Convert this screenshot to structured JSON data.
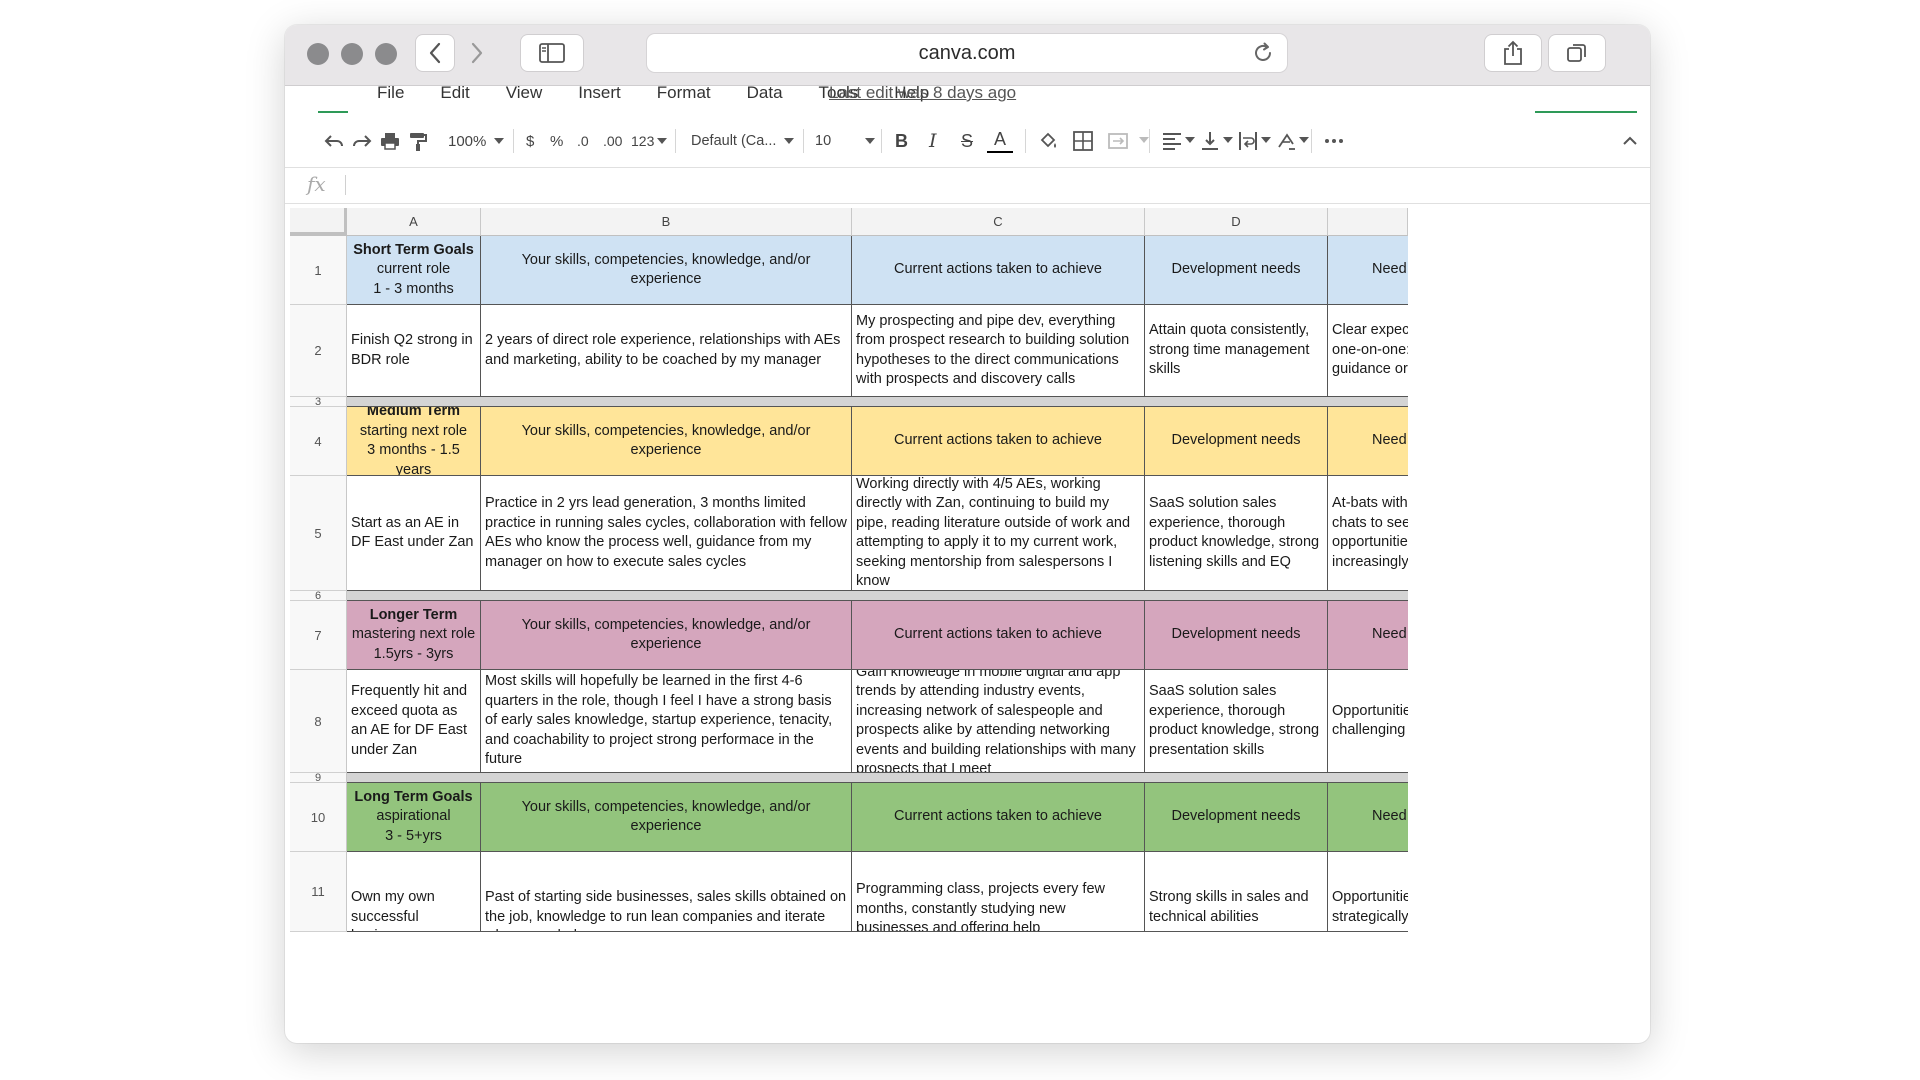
{
  "browser": {
    "url": "canva.com"
  },
  "menu": {
    "items": [
      "File",
      "Edit",
      "View",
      "Insert",
      "Format",
      "Data",
      "Tools",
      "Help"
    ],
    "last_edit": "Last edit was 8 days ago"
  },
  "toolbar": {
    "zoom": "100%",
    "currency": "$",
    "percent": "%",
    "dec_decrease": ".0",
    "dec_increase": ".00",
    "more_formats": "123",
    "font": "Default (Ca...",
    "font_size": "10",
    "bold": "B",
    "italic": "I",
    "strike": "S",
    "text_color": "A"
  },
  "formula_bar": {
    "fx": "fx",
    "value": ""
  },
  "columns": [
    "A",
    "B",
    "C",
    "D"
  ],
  "rows": [
    {
      "num": "1",
      "cells": [
        "Short Term Goals",
        "current role\n1 - 3 months",
        "Your skills, competencies, knowledge, and/or experience",
        "Current actions taken to achieve",
        "Development needs",
        "Need"
      ]
    },
    {
      "num": "2",
      "cells": [
        "Finish Q2 strong in BDR role",
        "2 years of direct role experience, relationships with AEs and marketing, ability to be coached by my manager",
        "My prospecting and pipe dev, everything from prospect research to building solution hypotheses to the direct communications with prospects and discovery calls",
        "Attain quota consistently, strong time management skills",
        "Clear expec\none-on-one:\nguidance or"
      ]
    },
    {
      "num": "3"
    },
    {
      "num": "4",
      "cells": [
        "Medium Term",
        "starting next role\n3 months - 1.5 years",
        "Your skills, competencies, knowledge, and/or experience",
        "Current actions taken to achieve",
        "Development needs",
        "Need"
      ]
    },
    {
      "num": "5",
      "cells": [
        "Start as an AE in DF East under Zan",
        "Practice in 2 yrs lead generation, 3 months limited practice in running sales cycles, collaboration with fellow AEs who know the process well, guidance from my manager on how to execute sales cycles",
        "Working directly with 4/5 AEs, working directly with Zan, continuing to build my pipe, reading literature outside of work and attempting to apply it to my current work, seeking mentorship from salespersons I know",
        "SaaS solution sales experience, thorough product knowledge, strong listening skills and EQ",
        "At-bats with I\nchats to seek\nopportunitie:\nincreasingly c"
      ]
    },
    {
      "num": "6"
    },
    {
      "num": "7",
      "cells": [
        "Longer Term",
        "mastering next role\n1.5yrs - 3yrs",
        "Your skills, competencies, knowledge, and/or experience",
        "Current actions taken to achieve",
        "Development needs",
        "Need"
      ]
    },
    {
      "num": "8",
      "cells": [
        "Frequently hit and exceed quota as an AE for DF East under Zan",
        "Most skills will hopefully be learned in the first 4-6 quarters in the role, though I feel I have a strong basis of early sales knowledge, startup experience, tenacity, and coachability to project strong performace in the future",
        "Gain knowledge in mobile digital and app trends by attending industry events, increasing network of salespeople and prospects alike by attending networking events and building relationships with many prospects that I meet",
        "SaaS solution sales experience, thorough product knowledge, strong presentation skills",
        "Opportunitie\nchallenging a"
      ]
    },
    {
      "num": "9"
    },
    {
      "num": "10",
      "cells": [
        "Long Term Goals",
        "aspirational\n3 - 5+yrs",
        "Your skills, competencies, knowledge, and/or experience",
        "Current actions taken to achieve",
        "Development needs",
        "Need"
      ]
    },
    {
      "num": "11",
      "cells": [
        "Own my own successful business",
        "Past of starting side businesses, sales skills obtained on the job, knowledge to run lean companies and iterate where needed",
        "Programming class, projects every few months, constantly studying new businesses and offering help",
        "Strong skills in sales and technical abilities",
        "Opportunitie\nstrategically"
      ]
    }
  ],
  "colors": {
    "short": "#cfe2f3",
    "medium": "#ffe599",
    "longer": "#d5a6bd",
    "long": "#93c47d",
    "gap": "#d4d4d4"
  }
}
